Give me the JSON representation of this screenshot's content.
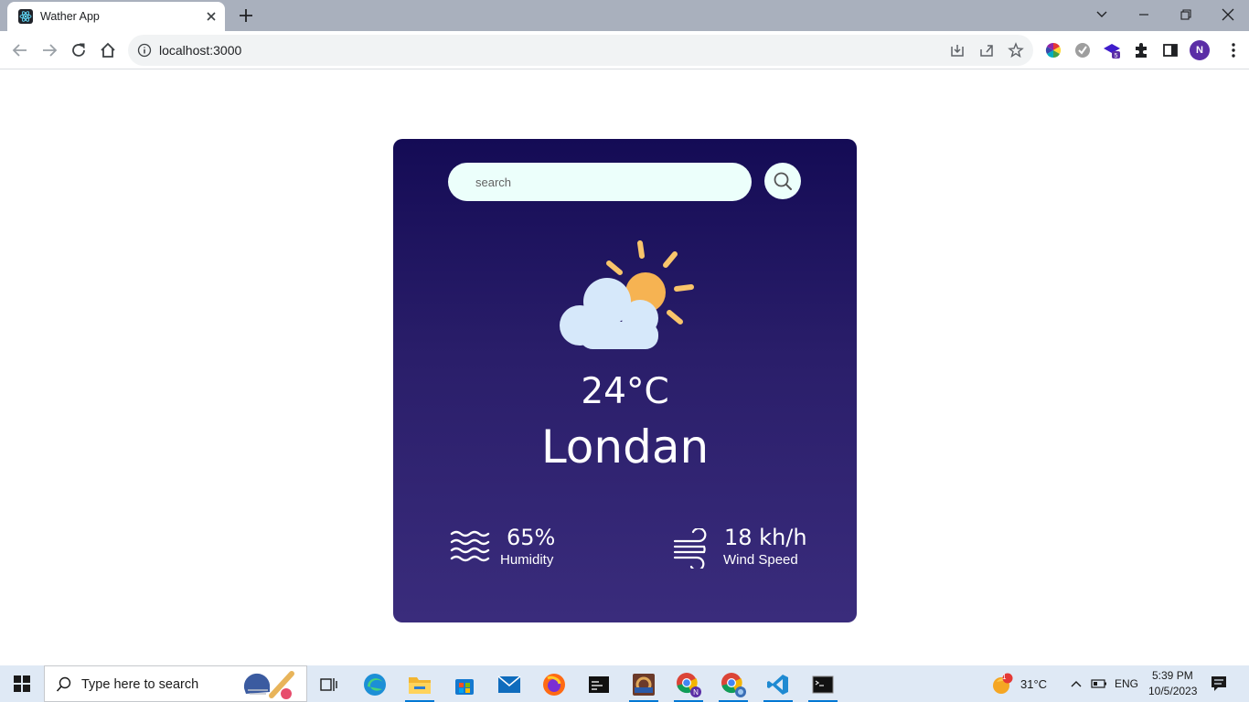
{
  "browser": {
    "tab_title": "Wather App",
    "url": "localhost:3000",
    "profile_initial": "N"
  },
  "weather": {
    "search_placeholder": "search",
    "temperature": "24°C",
    "city": "Londan",
    "humidity_value": "65%",
    "humidity_label": "Humidity",
    "wind_value": "18 kh/h",
    "wind_label": "Wind Speed",
    "icon": "partly-cloudy-icon"
  },
  "taskbar": {
    "search_placeholder": "Type here to search",
    "weather_temp": "31°C",
    "language": "ENG",
    "time": "5:39 PM",
    "date": "10/5/2023",
    "notification_count": "1"
  },
  "colors": {
    "card_top": "#140b55",
    "card_bottom": "#3a2c7c",
    "search_bg": "#ecfffb",
    "sun": "#f6b352",
    "cloud": "#d6e8fa"
  }
}
